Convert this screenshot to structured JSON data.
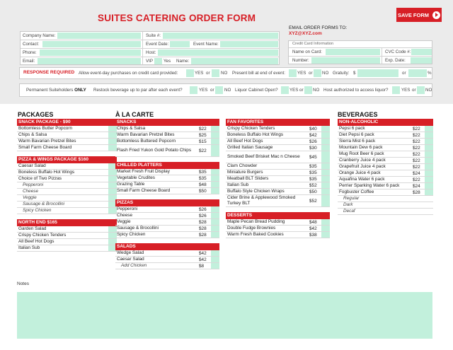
{
  "header": {
    "title": "SUITES CATERING ORDER FORM",
    "email_label": "EMAIL ORDER FORMS TO:",
    "email_address": "XYZ@XYZ.com",
    "save_label": "SAVE FORM"
  },
  "info": {
    "company": "Company Name:",
    "suite": "Suite #:",
    "contact": "Contact:",
    "event_date": "Event Date:",
    "event_name": "Event Name:",
    "phone": "Phone:",
    "host": "Host:",
    "email": "Email:",
    "vip": "VIP",
    "yes": "Yes",
    "name": "Name:"
  },
  "card": {
    "title": "Credit Card Information",
    "name_on_card": "Name on Card:",
    "cvc": "CVC Code #:",
    "number": "Number:",
    "exp": "Exp. Date:"
  },
  "response": {
    "required": "RESPONSE REQUIRED",
    "q1": "Allow event-day purchases on credit card provided:",
    "q2": "Present bill at end of event:",
    "gratuity": "Gratuity:",
    "dollar": "$",
    "or": "or",
    "percent": "%",
    "yes": "YES",
    "no": "NO"
  },
  "perm": {
    "label": "Permanent Suiteholders",
    "only": "ONLY",
    "q1": "Restock beverage up to par after each event?",
    "q2": "Liquor Cabinet Open?",
    "q3": "Host authorized to access liquor?",
    "yes": "YES",
    "no": "NO",
    "or": "or"
  },
  "sections": {
    "packages": "PACKAGES",
    "alacarte": "À LA CARTE",
    "beverages": "BEVERAGES"
  },
  "packages": [
    {
      "title": "SNACK PACKAGE - $90",
      "items": [
        {
          "name": "Bottomless Butter Popcorn"
        },
        {
          "name": "Chips & Salsa"
        },
        {
          "name": "Warm Bavarian Pretzel Bites"
        },
        {
          "name": "Small Farm Cheese Board"
        }
      ]
    },
    {
      "title": "PIZZA & WINGS PACKAGE $160",
      "items": [
        {
          "name": "Caesar Salad"
        },
        {
          "name": "Boneless Buffalo Hot Wings"
        },
        {
          "name": "Choice of Two Pizzas"
        },
        {
          "name": "Pepperoni",
          "sub": true
        },
        {
          "name": "Cheese",
          "sub": true
        },
        {
          "name": "Veggie",
          "sub": true
        },
        {
          "name": "Sausage & Brocollini",
          "sub": true
        },
        {
          "name": "Spicy Chicken",
          "sub": true
        }
      ]
    },
    {
      "title": "NORTH END $165",
      "items": [
        {
          "name": "Garden Salad"
        },
        {
          "name": "Crispy Chicken Tenders"
        },
        {
          "name": "All Beef Hot Dogs"
        },
        {
          "name": "Italian Sub"
        }
      ]
    }
  ],
  "alacarte": [
    {
      "title": "SNACKS",
      "items": [
        {
          "name": "Chips & Salsa",
          "price": "$22"
        },
        {
          "name": "Warm Bavarian Pretzel Bites",
          "price": "$25"
        },
        {
          "name": "Bottomless Buttered Popcorn",
          "price": "$15"
        },
        {
          "name": "Flash Fried Yukon Gold Potato Chips",
          "price": "$22",
          "tall": true
        }
      ]
    },
    {
      "title": "CHILLED PLATTERS",
      "items": [
        {
          "name": "Market Fresh Fruit Display",
          "price": "$35"
        },
        {
          "name": "Vegetable Crudites",
          "price": "$35"
        },
        {
          "name": "Grazing Table",
          "price": "$48"
        },
        {
          "name": "Small Farm Cheese Board",
          "price": "$50"
        }
      ]
    },
    {
      "title": "PIZZAS",
      "items": [
        {
          "name": "Pepperoni",
          "price": "$26"
        },
        {
          "name": "Cheese",
          "price": "$26"
        },
        {
          "name": "Veggie",
          "price": "$28"
        },
        {
          "name": "Sausage & Brocollini",
          "price": "$28"
        },
        {
          "name": "Spicy Chicken",
          "price": "$28"
        }
      ]
    },
    {
      "title": "SALADS",
      "items": [
        {
          "name": "Wedge Salad",
          "price": "$42"
        },
        {
          "name": "Caesar Salad",
          "price": "$42"
        },
        {
          "name": "Add Chicken",
          "price": "$8",
          "sub": true
        }
      ]
    }
  ],
  "fan": [
    {
      "title": "FAN FAVORITES",
      "items": [
        {
          "name": "Crispy Chicken Tenders",
          "price": "$40"
        },
        {
          "name": "Boneless Buffalo Hot Wings",
          "price": "$42"
        },
        {
          "name": "All Beef Hot Dogs",
          "price": "$26"
        },
        {
          "name": "Grilled Italian Sausage",
          "price": "$30"
        },
        {
          "name": "Smoked Beef Brisket Mac n Cheese",
          "price": "$45",
          "tall": true
        },
        {
          "name": "Clam Chowder",
          "price": "$35"
        },
        {
          "name": "Miniature Burgers",
          "price": "$35"
        },
        {
          "name": "Meatball BLT Sliders",
          "price": "$35"
        },
        {
          "name": "Italian Sub",
          "price": "$52"
        },
        {
          "name": "Buffalo Style Chicken Wraps",
          "price": "$50"
        },
        {
          "name": "Cider Brine & Applewood Smoked Turkey BLT",
          "price": "$52",
          "tall": true
        }
      ]
    },
    {
      "title": "DESSERTS",
      "items": [
        {
          "name": "Maple Pecan Bread Pudding",
          "price": "$48"
        },
        {
          "name": "Double Fudge Brownies",
          "price": "$42"
        },
        {
          "name": "Warm Fresh Baked Cookies",
          "price": "$38"
        }
      ]
    }
  ],
  "beverages": [
    {
      "title": "NON-ALCOHOLIC",
      "items": [
        {
          "name": "Pepsi 6 pack",
          "price": "$22"
        },
        {
          "name": "Diet Pepsi 6 pack",
          "price": "$22"
        },
        {
          "name": "Sierra Mist 6 pack",
          "price": "$22"
        },
        {
          "name": "Mountain Dew 6 pack",
          "price": "$22"
        },
        {
          "name": "Mug Root Beer 6 pack",
          "price": "$22"
        },
        {
          "name": "Cranberry Juice 4 pack",
          "price": "$22"
        },
        {
          "name": "Grapefruit Juice 4 pack",
          "price": "$22"
        },
        {
          "name": "Orange Juice 4 pack",
          "price": "$24"
        },
        {
          "name": "Aquafina Water 6 pack",
          "price": "$22"
        },
        {
          "name": "Perrier Sparking Water 6 pack",
          "price": "$24"
        },
        {
          "name": "Fogbuster Coffee",
          "price": "$28"
        },
        {
          "name": "Regular",
          "sub": true,
          "nofield": true
        },
        {
          "name": "Dark",
          "sub": true,
          "nofield": true
        },
        {
          "name": "Decaf",
          "sub": true,
          "nofield": true
        }
      ]
    }
  ],
  "notes": {
    "label": "Notes"
  }
}
